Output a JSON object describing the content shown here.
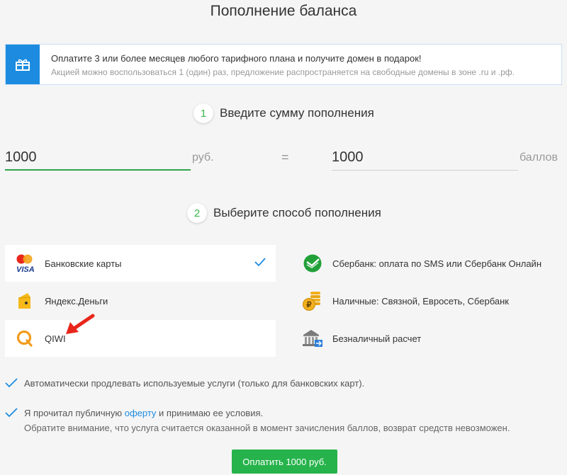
{
  "page": {
    "title": "Пополнение баланса"
  },
  "promo": {
    "icon": "gift-icon",
    "headline": "Оплатите 3 или более месяцев любого тарифного плана и получите домен в подарок!",
    "subtext": "Акцией можно воспользоваться 1 (один) раз, предложение распространяется на свободные домены в зоне .ru и .рф."
  },
  "step1": {
    "number": "1",
    "label": "Введите сумму пополнения"
  },
  "amount": {
    "value": "1000",
    "unit": "руб.",
    "equals": "="
  },
  "points": {
    "value": "1000",
    "unit": "баллов"
  },
  "step2": {
    "number": "2",
    "label": "Выберите способ пополнения"
  },
  "methods": {
    "bank_cards": {
      "label": "Банковские карты",
      "icon": "mastercard-visa-icon",
      "selected": true
    },
    "sberbank": {
      "label": "Сбербанк: оплата по SMS или Сбербанк Онлайн",
      "icon": "sberbank-icon"
    },
    "yandex": {
      "label": "Яндекс.Деньги",
      "icon": "yandex-money-icon"
    },
    "cash": {
      "label": "Наличные: Связной, Евросеть, Сбербанк",
      "icon": "coins-ruble-icon"
    },
    "qiwi": {
      "label": "QIWI",
      "icon": "qiwi-icon"
    },
    "cashless": {
      "label": "Безналичный расчет",
      "icon": "bank-building-icon"
    }
  },
  "options": {
    "autorenew": "Автоматически продлевать используемые услуги (только для банковских карт).",
    "offer_before": "Я прочитал публичную",
    "offer_link": "оферту",
    "offer_after": "и принимаю ее условия.",
    "notice": "Обратите внимание, что услуга считается оказанной в момент зачисления баллов, возврат средств невозможен."
  },
  "pay_button": "Оплатить 1000 руб.",
  "colors": {
    "accent_green": "#26b34b",
    "link_blue": "#1d8ce0",
    "annotation_red": "#e8261b"
  }
}
